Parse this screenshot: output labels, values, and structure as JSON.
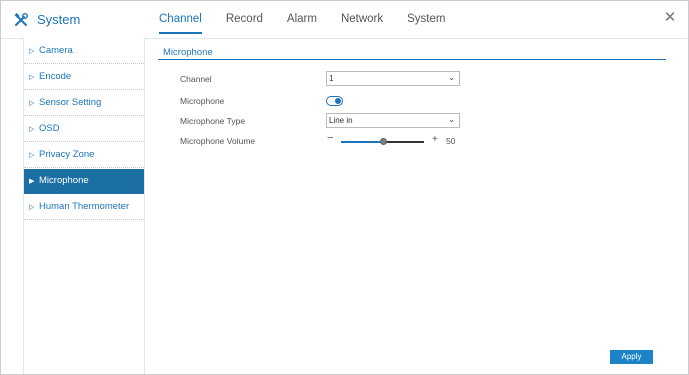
{
  "header": {
    "brand_icon": "tools-icon",
    "title": "System",
    "close_icon": "close-icon",
    "tabs": [
      {
        "label": "Channel"
      },
      {
        "label": "Record"
      },
      {
        "label": "Alarm"
      },
      {
        "label": "Network"
      },
      {
        "label": "System"
      }
    ],
    "active_tab": "Channel"
  },
  "sidebar": {
    "items": [
      {
        "label": "Camera"
      },
      {
        "label": "Encode"
      },
      {
        "label": "Sensor Setting"
      },
      {
        "label": "OSD"
      },
      {
        "label": "Privacy Zone"
      },
      {
        "label": "Microphone"
      },
      {
        "label": "Human Thermometer"
      }
    ],
    "active_item": "Microphone"
  },
  "main": {
    "section_title": "Microphone",
    "fields": {
      "channel": {
        "label": "Channel",
        "value": "1"
      },
      "microphone": {
        "label": "Microphone",
        "enabled": true
      },
      "type": {
        "label": "Microphone Type",
        "value": "Line in"
      },
      "volume": {
        "label": "Microphone Volume",
        "minus": "−",
        "plus": "+",
        "value": "50",
        "level_percent": 50
      }
    },
    "apply_label": "Apply"
  },
  "colors": {
    "accent": "#1b75bb",
    "sidebar_active_bg": "#1c6fa3",
    "apply_bg": "#1c83c6"
  }
}
